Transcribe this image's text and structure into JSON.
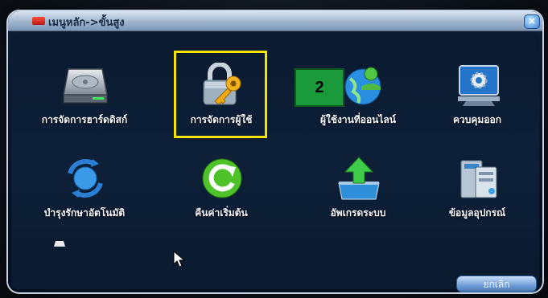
{
  "window": {
    "title": "เมนูหลัก->ขั้นสูง",
    "close_icon": "close-icon"
  },
  "menu_items": [
    {
      "label": "การจัดการฮาร์ดดิสก์",
      "icon": "hard-disk-icon"
    },
    {
      "label": "การจัดการผู้ใช้",
      "icon": "lock-key-icon",
      "highlighted": true
    },
    {
      "label": "ผู้ใช้งานที่ออนไลน์",
      "icon": "online-users-globe-icon"
    },
    {
      "label": "ควบคุมออก",
      "icon": "gear-monitor-icon"
    },
    {
      "label": "บำรุงรักษาอัตโนมัติ",
      "icon": "sync-globe-icon"
    },
    {
      "label": "คืนค่าเริ่มต้น",
      "icon": "refresh-icon"
    },
    {
      "label": "อัพเกรดระบบ",
      "icon": "upload-tray-icon"
    },
    {
      "label": "ข้อมูลอุปกรณ์",
      "icon": "device-info-icon"
    }
  ],
  "annotation": {
    "step_number": "2",
    "highlight_color": "#f5e400",
    "badge_color": "#1a9a3a"
  },
  "footer": {
    "cancel_label": "ยกเลิก"
  }
}
